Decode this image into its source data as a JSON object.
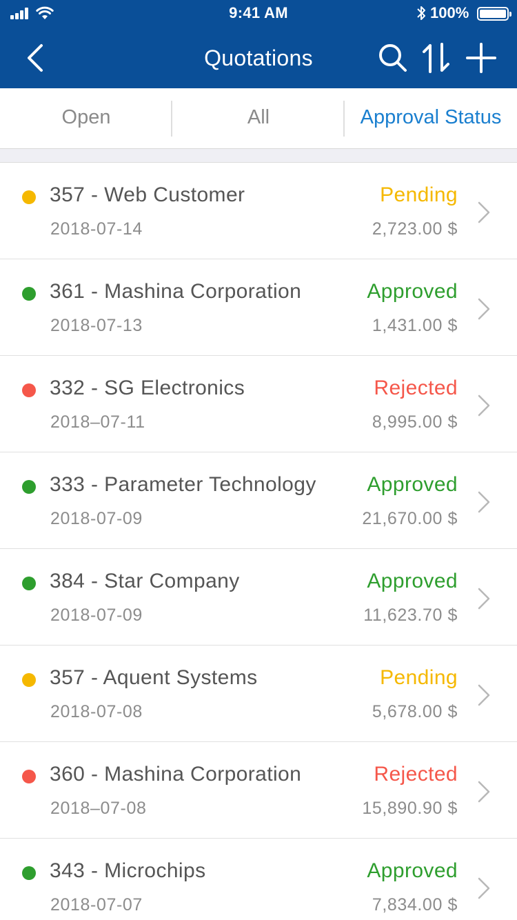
{
  "status_bar": {
    "time": "9:41 AM",
    "battery_percent": "100%"
  },
  "nav": {
    "title": "Quotations",
    "icons": [
      "chevron-left-icon",
      "search-icon",
      "sort-icon",
      "plus-icon"
    ]
  },
  "tabs": [
    {
      "label": "Open",
      "active": false
    },
    {
      "label": "All",
      "active": false
    },
    {
      "label": "Approval Status",
      "active": true
    }
  ],
  "colors": {
    "header": "#0a4f98",
    "active_tab": "#1a7fcf",
    "Pending": "#f5b800",
    "Approved": "#2e9e2e",
    "Rejected": "#f5574a"
  },
  "quotations": [
    {
      "title": "357 - Web Customer",
      "date": "2018-07-14",
      "status": "Pending",
      "amount": "2,723.00 $"
    },
    {
      "title": "361 - Mashina Corporation",
      "date": "2018-07-13",
      "status": "Approved",
      "amount": "1,431.00 $"
    },
    {
      "title": "332 - SG Electronics",
      "date": "2018–07-11",
      "status": "Rejected",
      "amount": "8,995.00 $"
    },
    {
      "title": "333 - Parameter Technology",
      "date": "2018-07-09",
      "status": "Approved",
      "amount": "21,670.00 $"
    },
    {
      "title": "384 - Star Company",
      "date": "2018-07-09",
      "status": "Approved",
      "amount": "11,623.70 $"
    },
    {
      "title": "357 - Aquent Systems",
      "date": "2018-07-08",
      "status": "Pending",
      "amount": "5,678.00 $"
    },
    {
      "title": "360 - Mashina Corporation",
      "date": "2018–07-08",
      "status": "Rejected",
      "amount": "15,890.90 $"
    },
    {
      "title": "343 - Microchips",
      "date": "2018-07-07",
      "status": "Approved",
      "amount": "7,834.00 $"
    }
  ]
}
